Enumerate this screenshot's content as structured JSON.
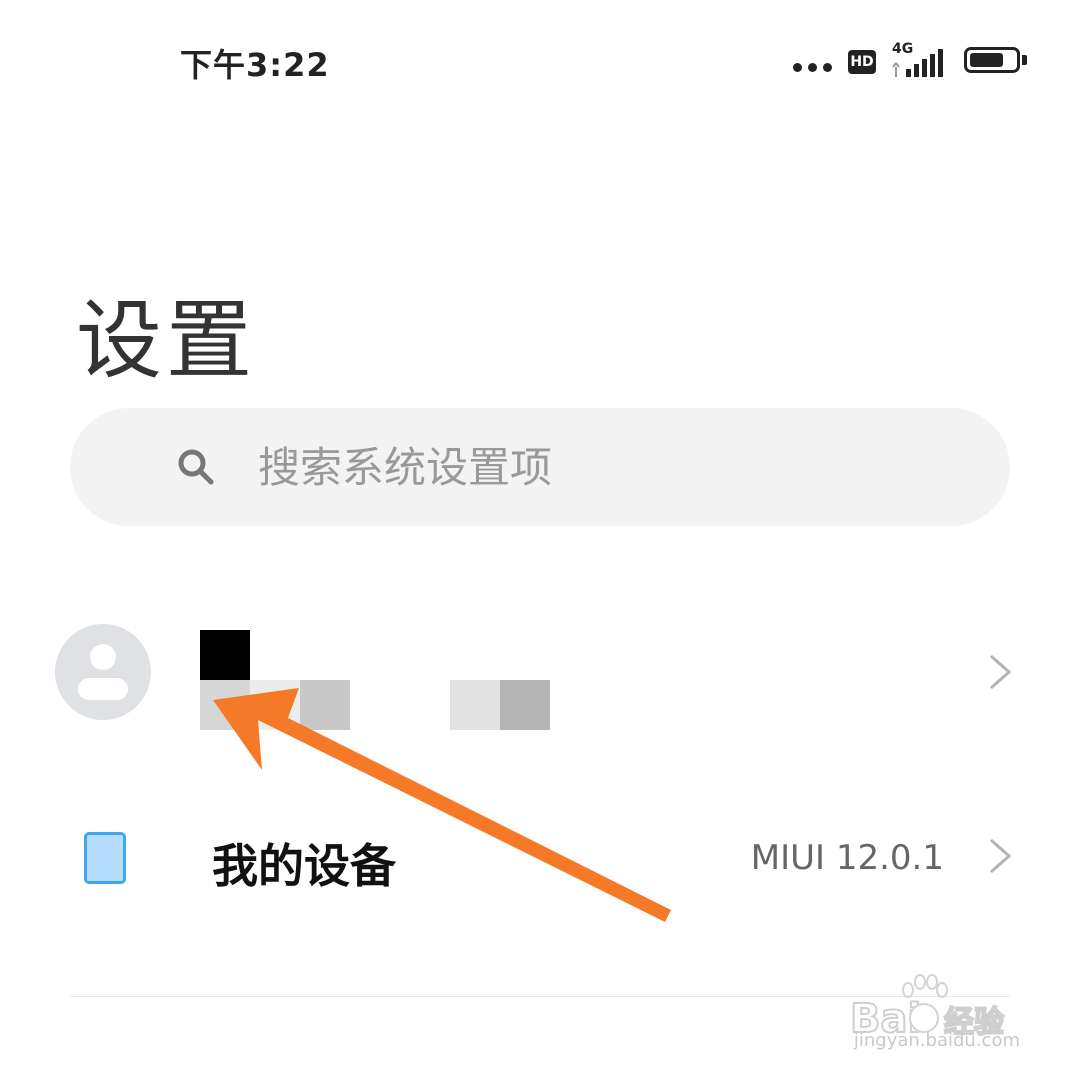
{
  "status_bar": {
    "time": "下午3:22",
    "hd_label": "HD",
    "network_label": "4G",
    "battery_level_percent": 75
  },
  "header": {
    "title": "设置"
  },
  "search": {
    "placeholder": "搜索系统设置项"
  },
  "account_row": {
    "icon": "avatar-icon",
    "chevron": "chevron-right-icon"
  },
  "device_row": {
    "label": "我的设备",
    "version": "MIUI 12.0.1",
    "icon": "device-icon",
    "chevron": "chevron-right-icon"
  },
  "overlay": {
    "arrow_color": "#f57a28"
  },
  "watermark": {
    "url": "jingyan.baidu.com"
  },
  "colors": {
    "search_bg": "#f3f3f3",
    "avatar_bg": "#dfe1e5",
    "device_icon_fill": "#b5dcfb",
    "device_icon_stroke": "#3fa7ef"
  }
}
